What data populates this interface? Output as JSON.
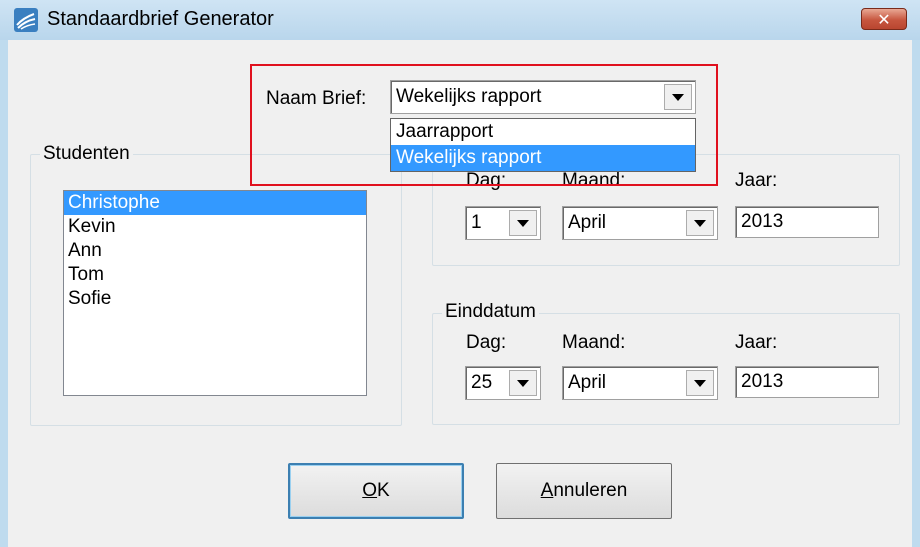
{
  "window": {
    "title": "Standaardbrief Generator",
    "close_glyph": "✕",
    "app_icon": "wind-swirl-icon"
  },
  "letter": {
    "label": "Naam Brief:",
    "selected": "Wekelijks rapport",
    "options": [
      "Jaarrapport",
      "Wekelijks rapport"
    ],
    "highlight_color": "#e0101e"
  },
  "students": {
    "group_label": "Studenten",
    "items": [
      "Christophe",
      "Kevin",
      "Ann",
      "Tom",
      "Sofie"
    ],
    "selected_index": 0
  },
  "start_date": {
    "day_label": "Dag:",
    "month_label": "Maand:",
    "year_label": "Jaar:",
    "day": "1",
    "month": "April",
    "year": "2013"
  },
  "end_date": {
    "group_label": "Einddatum",
    "day_label": "Dag:",
    "month_label": "Maand:",
    "year_label": "Jaar:",
    "day": "25",
    "month": "April",
    "year": "2013"
  },
  "buttons": {
    "ok_mnemonic": "O",
    "ok_rest": "K",
    "cancel_mnemonic": "A",
    "cancel_rest": "nnuleren"
  },
  "colors": {
    "selection": "#3399ff",
    "title_bar": "#bfdbee",
    "close_button": "#c7563f"
  }
}
